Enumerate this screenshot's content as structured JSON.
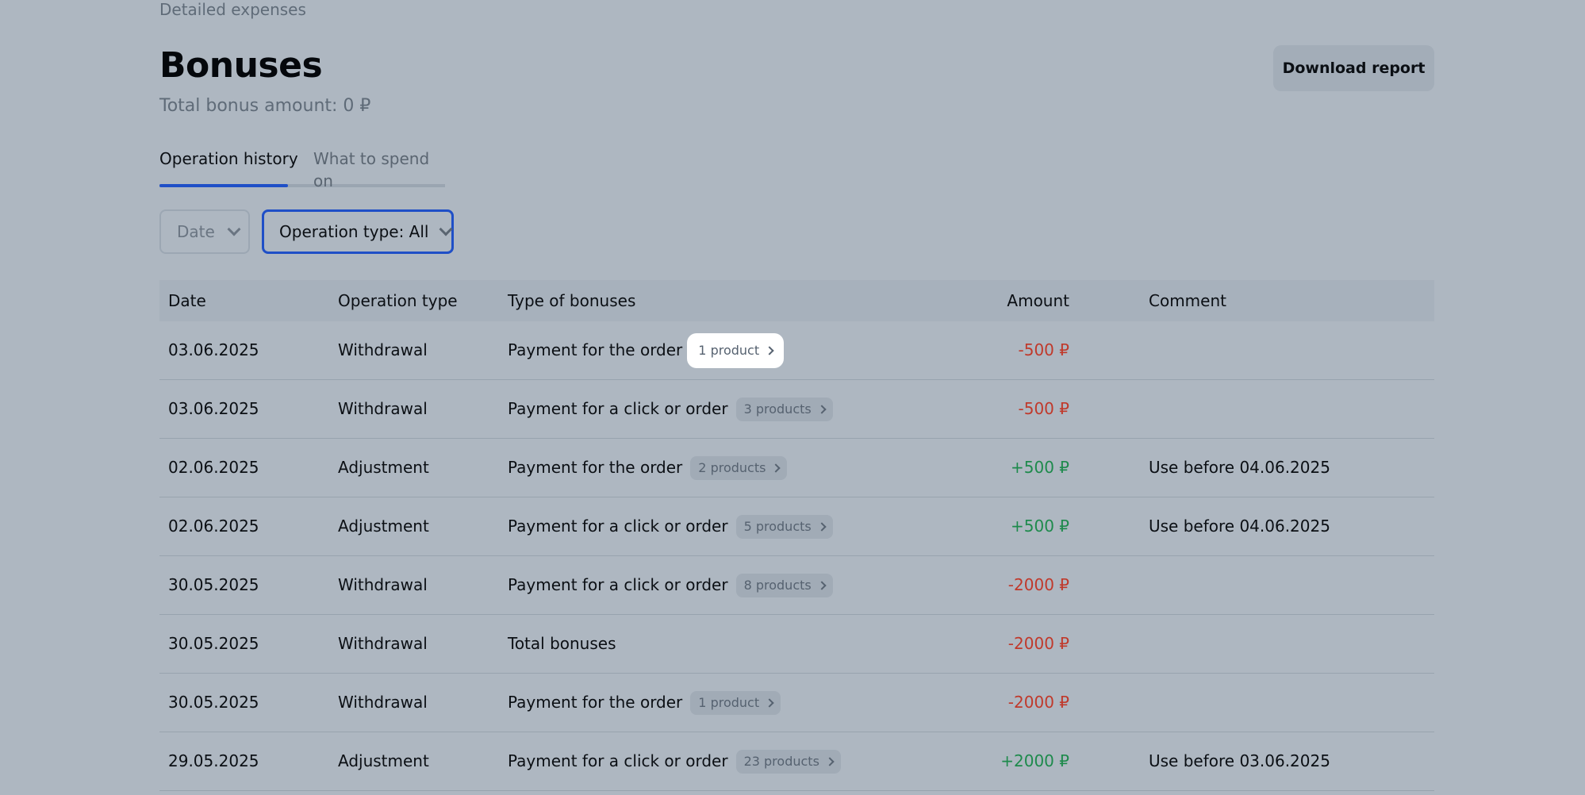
{
  "breadcrumb": "Detailed expenses",
  "title": "Bonuses",
  "total_bonus": "Total bonus amount: 0 ₽",
  "download_label": "Download report",
  "tabs": [
    {
      "label": "Operation history",
      "active": true
    },
    {
      "label": "What to spend on",
      "active": false
    }
  ],
  "filters": {
    "date_label": "Date",
    "operation_type_label": "Operation type: All"
  },
  "table": {
    "headers": {
      "date": "Date",
      "operation_type": "Operation type",
      "type_of_bonuses": "Type of bonuses",
      "amount": "Amount",
      "comment": "Comment"
    },
    "rows": [
      {
        "date": "03.06.2025",
        "operation_type": "Withdrawal",
        "type": "Payment for the order",
        "chip": "1 product",
        "amount": "-500 ₽",
        "sign": "neg",
        "comment": ""
      },
      {
        "date": "03.06.2025",
        "operation_type": "Withdrawal",
        "type": "Payment for a click or order",
        "chip": "3 products",
        "amount": "-500 ₽",
        "sign": "neg",
        "comment": ""
      },
      {
        "date": "02.06.2025",
        "operation_type": "Adjustment",
        "type": "Payment for the order",
        "chip": "2 products",
        "amount": "+500 ₽",
        "sign": "pos",
        "comment": "Use before 04.06.2025"
      },
      {
        "date": "02.06.2025",
        "operation_type": "Adjustment",
        "type": "Payment for a click or order",
        "chip": "5 products",
        "amount": "+500 ₽",
        "sign": "pos",
        "comment": "Use before 04.06.2025"
      },
      {
        "date": "30.05.2025",
        "operation_type": "Withdrawal",
        "type": "Payment for a click or order",
        "chip": "8 products",
        "amount": "-2000 ₽",
        "sign": "neg",
        "comment": ""
      },
      {
        "date": "30.05.2025",
        "operation_type": "Withdrawal",
        "type": "Total bonuses",
        "chip": "",
        "amount": "-2000 ₽",
        "sign": "neg",
        "comment": ""
      },
      {
        "date": "30.05.2025",
        "operation_type": "Withdrawal",
        "type": "Payment for the order",
        "chip": "1 product",
        "amount": "-2000 ₽",
        "sign": "neg",
        "comment": ""
      },
      {
        "date": "29.05.2025",
        "operation_type": "Adjustment",
        "type": "Payment for a click or order",
        "chip": "23 products",
        "amount": "+2000 ₽",
        "sign": "pos",
        "comment": "Use before 03.06.2025"
      }
    ]
  },
  "colors": {
    "accent": "#1f4fc7",
    "negative": "#c0392b",
    "positive": "#1e8a4c",
    "background": "#aeb7c1"
  }
}
